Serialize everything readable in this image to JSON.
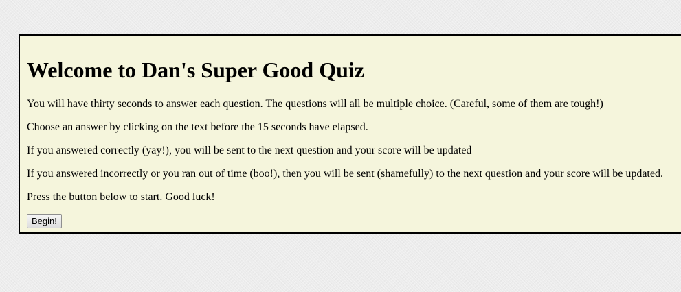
{
  "quiz": {
    "title": "Welcome to Dan's Super Good Quiz",
    "instructions": [
      "You will have thirty seconds to answer each question. The questions will all be multiple choice. (Careful, some of them are tough!)",
      "Choose an answer by clicking on the text before the 15 seconds have elapsed.",
      "If you answered correctly (yay!), you will be sent to the next question and your score will be updated",
      "If you answered incorrectly or you ran out of time (boo!), then you will be sent (shamefully) to the next question and your score will be updated.",
      "Press the button below to start. Good luck!"
    ],
    "begin_label": "Begin!"
  },
  "colors": {
    "panel_background": "#f5f5dc",
    "panel_border": "#000000",
    "page_background": "#ececec"
  }
}
